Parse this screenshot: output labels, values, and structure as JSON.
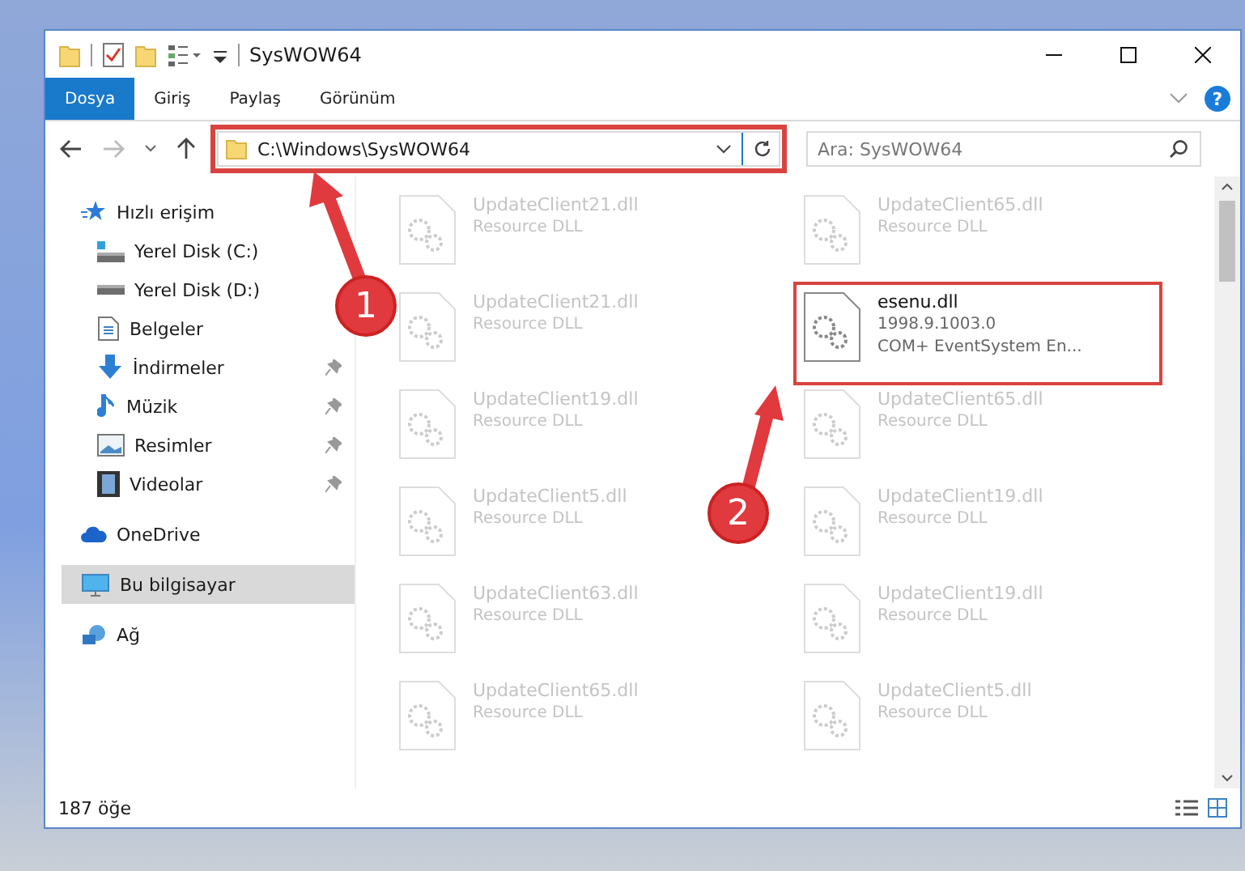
{
  "window": {
    "title": "SysWOW64"
  },
  "ribbon_tabs": [
    {
      "label": "Dosya",
      "selected": true
    },
    {
      "label": "Giriş",
      "selected": false
    },
    {
      "label": "Paylaş",
      "selected": false
    },
    {
      "label": "Görünüm",
      "selected": false
    }
  ],
  "help_button": "?",
  "address_bar": {
    "path": "C:\\Windows\\SysWOW64",
    "annotated": true
  },
  "search": {
    "placeholder": "Ara: SysWOW64"
  },
  "sidebar": {
    "items": [
      {
        "label": "Hızlı erişim",
        "selected": false,
        "children": [
          {
            "label": "Yerel Disk (C:)"
          },
          {
            "label": "Yerel Disk (D:)"
          },
          {
            "label": "Belgeler"
          },
          {
            "label": "İndirmeler",
            "pinned": true
          },
          {
            "label": "Müzik",
            "pinned": true
          },
          {
            "label": "Resimler",
            "pinned": true
          },
          {
            "label": "Videolar",
            "pinned": true
          }
        ]
      },
      {
        "label": "OneDrive",
        "selected": false
      },
      {
        "label": "Bu bilgisayar",
        "selected": true
      },
      {
        "label": "Ağ",
        "selected": false
      }
    ]
  },
  "files": [
    {
      "name": "UpdateClient21.dll",
      "details": [
        "Resource DLL"
      ],
      "dimmed": true,
      "annotated": false
    },
    {
      "name": "UpdateClient65.dll",
      "details": [
        "Resource DLL"
      ],
      "dimmed": true,
      "annotated": false
    },
    {
      "name": "UpdateClient21.dll",
      "details": [
        "Resource DLL"
      ],
      "dimmed": true,
      "annotated": false
    },
    {
      "name": "esenu.dll",
      "details": [
        "1998.9.1003.0",
        "COM+ EventSystem En..."
      ],
      "dimmed": false,
      "annotated": true
    },
    {
      "name": "UpdateClient19.dll",
      "details": [
        "Resource DLL"
      ],
      "dimmed": true,
      "annotated": false
    },
    {
      "name": "UpdateClient65.dll",
      "details": [
        "Resource DLL"
      ],
      "dimmed": true,
      "annotated": false
    },
    {
      "name": "UpdateClient5.dll",
      "details": [
        "Resource DLL"
      ],
      "dimmed": true,
      "annotated": false
    },
    {
      "name": "UpdateClient19.dll",
      "details": [
        "Resource DLL"
      ],
      "dimmed": true,
      "annotated": false
    },
    {
      "name": "UpdateClient63.dll",
      "details": [
        "Resource DLL"
      ],
      "dimmed": true,
      "annotated": false
    },
    {
      "name": "UpdateClient19.dll",
      "details": [
        "Resource DLL"
      ],
      "dimmed": true,
      "annotated": false
    },
    {
      "name": "UpdateClient65.dll",
      "details": [
        "Resource DLL"
      ],
      "dimmed": true,
      "annotated": false
    },
    {
      "name": "UpdateClient5.dll",
      "details": [
        "Resource DLL"
      ],
      "dimmed": true,
      "annotated": false
    }
  ],
  "status_bar": {
    "item_count": "187 öğe"
  },
  "callouts": [
    {
      "number": "1"
    },
    {
      "number": "2"
    }
  ]
}
